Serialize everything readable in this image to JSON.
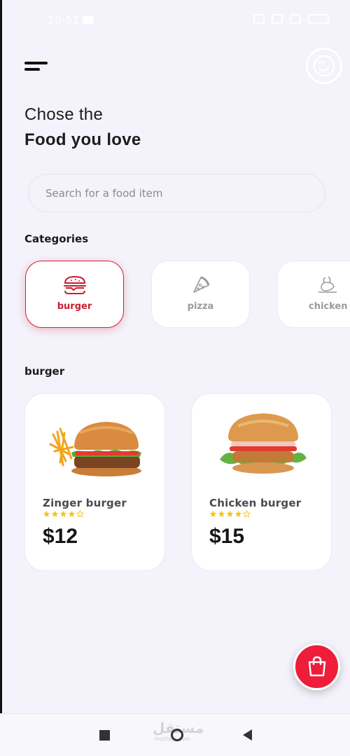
{
  "status_bar": {
    "time": "20:51"
  },
  "header": {
    "title_line1": "Chose the",
    "title_line2": "Food you love"
  },
  "search": {
    "placeholder": "Search for a food item",
    "value": ""
  },
  "categories": {
    "title": "Categories",
    "items": [
      {
        "label": "burger",
        "icon": "burger-icon",
        "selected": true
      },
      {
        "label": "pizza",
        "icon": "pizza-icon",
        "selected": false
      },
      {
        "label": "chicken",
        "icon": "chicken-icon",
        "selected": false
      }
    ]
  },
  "products": {
    "title": "burger",
    "items": [
      {
        "name": "Zinger burger",
        "rating": 4,
        "max_rating": 5,
        "price": "$12"
      },
      {
        "name": "Chicken burger",
        "rating": 4,
        "max_rating": 5,
        "price": "$15"
      }
    ]
  },
  "cart": {
    "icon": "shopping-bag-icon"
  },
  "watermark": {
    "logo_text": "مستقل",
    "domain": "mostaql.com"
  },
  "colors": {
    "accent": "#ee1d3a",
    "selected_category": "#c91d30",
    "background": "#f4f3fb",
    "card": "#ffffff",
    "star": "#f5c518"
  }
}
